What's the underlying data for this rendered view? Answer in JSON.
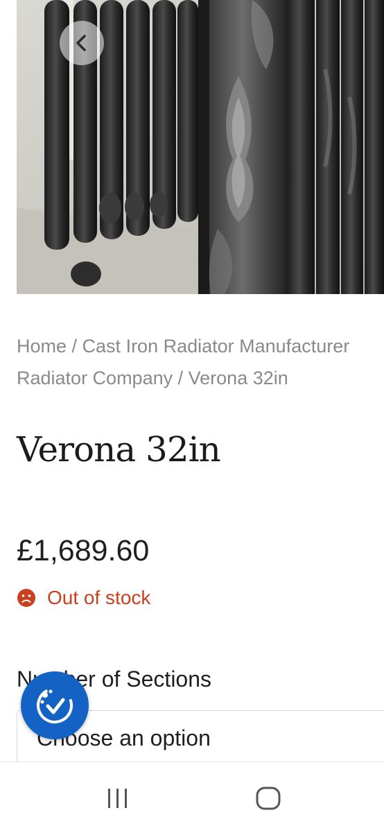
{
  "product_image": {
    "alt": "cast-iron-radiator-photo"
  },
  "back_button": {
    "icon": "chevron-left-icon"
  },
  "breadcrumb": {
    "line1": {
      "home": "Home",
      "sep": " / ",
      "category": "Cast Iron Radiator Manufacturer"
    },
    "line2": {
      "brand": "Radiator Company",
      "sep": " / ",
      "current": "Verona 32in"
    }
  },
  "product": {
    "title": "Verona 32in",
    "price": "£1,689.60",
    "stock_status": "Out of stock",
    "stock_icon": "sad-face-icon"
  },
  "variation": {
    "label": "Number of Sections",
    "select_value": "Choose an option"
  },
  "accessibility_button": {
    "icon": "accessibility-check-icon"
  },
  "system_nav": {
    "recents_icon": "recents-icon",
    "home_icon": "home-icon"
  },
  "colors": {
    "out_of_stock": "#c8401e",
    "accessibility_blue": "#1463c4",
    "breadcrumb_grey": "#8a8a8a"
  }
}
